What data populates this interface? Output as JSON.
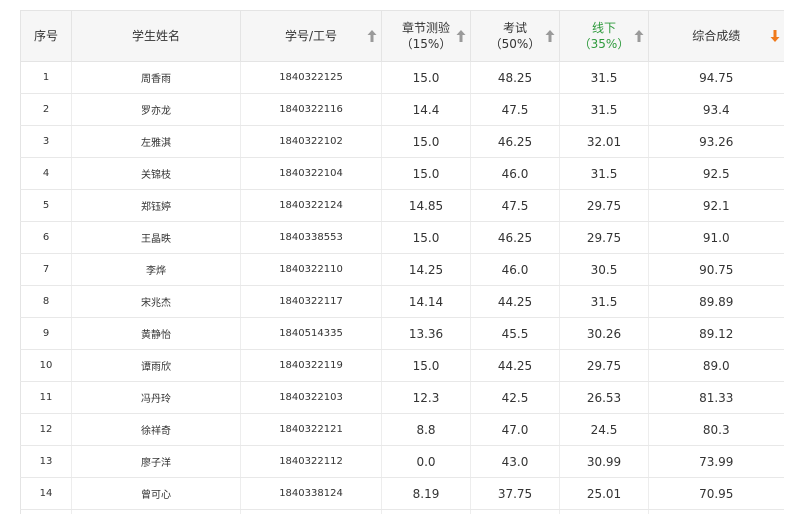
{
  "columns": [
    {
      "label": "序号",
      "sub": ""
    },
    {
      "label": "学生姓名",
      "sub": ""
    },
    {
      "label": "学号/工号",
      "sub": ""
    },
    {
      "label": "章节测验",
      "sub": "（15%）"
    },
    {
      "label": "考试",
      "sub": "（50%）"
    },
    {
      "label": "线下",
      "sub": "（35%）"
    },
    {
      "label": "综合成绩",
      "sub": ""
    }
  ],
  "colors": {
    "accent_green": "#2e9a3c",
    "sort_active_orange": "#f07a1a",
    "sort_inactive_gray": "#9a9a9a"
  },
  "rows": [
    {
      "idx": "1",
      "name": "周香雨",
      "id": "1840322125",
      "quiz": "15.0",
      "exam": "48.25",
      "offline": "31.5",
      "total": "94.75"
    },
    {
      "idx": "2",
      "name": "罗亦龙",
      "id": "1840322116",
      "quiz": "14.4",
      "exam": "47.5",
      "offline": "31.5",
      "total": "93.4"
    },
    {
      "idx": "3",
      "name": "左雅淇",
      "id": "1840322102",
      "quiz": "15.0",
      "exam": "46.25",
      "offline": "32.01",
      "total": "93.26"
    },
    {
      "idx": "4",
      "name": "关锦枝",
      "id": "1840322104",
      "quiz": "15.0",
      "exam": "46.0",
      "offline": "31.5",
      "total": "92.5"
    },
    {
      "idx": "5",
      "name": "郑钰婷",
      "id": "1840322124",
      "quiz": "14.85",
      "exam": "47.5",
      "offline": "29.75",
      "total": "92.1"
    },
    {
      "idx": "6",
      "name": "王晶昳",
      "id": "1840338553",
      "quiz": "15.0",
      "exam": "46.25",
      "offline": "29.75",
      "total": "91.0"
    },
    {
      "idx": "7",
      "name": "李烨",
      "id": "1840322110",
      "quiz": "14.25",
      "exam": "46.0",
      "offline": "30.5",
      "total": "90.75"
    },
    {
      "idx": "8",
      "name": "宋兆杰",
      "id": "1840322117",
      "quiz": "14.14",
      "exam": "44.25",
      "offline": "31.5",
      "total": "89.89"
    },
    {
      "idx": "9",
      "name": "黄静怡",
      "id": "1840514335",
      "quiz": "13.36",
      "exam": "45.5",
      "offline": "30.26",
      "total": "89.12"
    },
    {
      "idx": "10",
      "name": "谭雨欣",
      "id": "1840322119",
      "quiz": "15.0",
      "exam": "44.25",
      "offline": "29.75",
      "total": "89.0"
    },
    {
      "idx": "11",
      "name": "冯丹玲",
      "id": "1840322103",
      "quiz": "12.3",
      "exam": "42.5",
      "offline": "26.53",
      "total": "81.33"
    },
    {
      "idx": "12",
      "name": "徐祥奇",
      "id": "1840322121",
      "quiz": "8.8",
      "exam": "47.0",
      "offline": "24.5",
      "total": "80.3"
    },
    {
      "idx": "13",
      "name": "廖子洋",
      "id": "1840322112",
      "quiz": "0.0",
      "exam": "43.0",
      "offline": "30.99",
      "total": "73.99"
    },
    {
      "idx": "14",
      "name": "曾可心",
      "id": "1840338124",
      "quiz": "8.19",
      "exam": "37.75",
      "offline": "25.01",
      "total": "70.95"
    }
  ]
}
